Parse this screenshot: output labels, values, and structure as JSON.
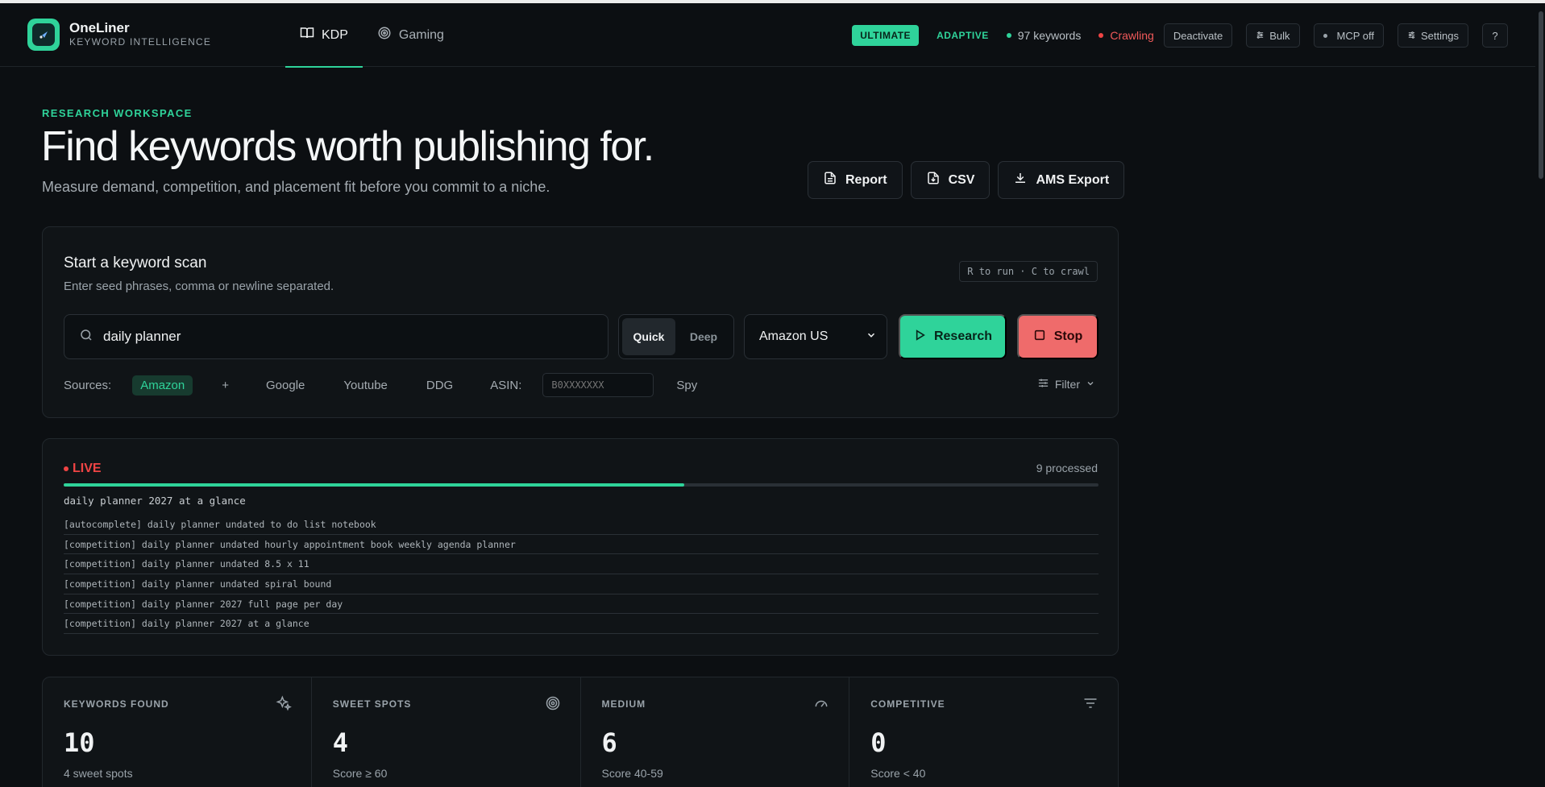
{
  "brand": {
    "name": "OneLiner",
    "subtitle": "KEYWORD INTELLIGENCE"
  },
  "nav": {
    "tabs": [
      {
        "label": "KDP",
        "icon": "book-icon",
        "active": true
      },
      {
        "label": "Gaming",
        "icon": "target-icon",
        "active": false
      }
    ]
  },
  "header": {
    "plan_badge": "ULTIMATE",
    "mode_label": "ADAPTIVE",
    "keywords_status": "97 keywords",
    "crawl_status": "Crawling",
    "deactivate": "Deactivate",
    "bulk": "Bulk",
    "mcp": "MCP off",
    "settings": "Settings",
    "help": "?"
  },
  "hero": {
    "eyebrow": "RESEARCH WORKSPACE",
    "title": "Find keywords worth publishing for.",
    "subtitle": "Measure demand, competition, and placement fit before you commit to a niche."
  },
  "actions": {
    "report": "Report",
    "csv": "CSV",
    "ams_export": "AMS Export"
  },
  "scan": {
    "title": "Start a keyword scan",
    "subtitle": "Enter seed phrases, comma or newline separated.",
    "shortcut_hint": "R to run · C to crawl",
    "query": "daily planner",
    "mode_quick": "Quick",
    "mode_deep": "Deep",
    "marketplace": "Amazon US",
    "research": "Research",
    "stop": "Stop",
    "sources_label": "Sources:",
    "src_amazon": "Amazon",
    "src_plus": "+",
    "src_google": "Google",
    "src_youtube": "Youtube",
    "src_ddg": "DDG",
    "asin_label": "ASIN:",
    "asin_placeholder": "B0XXXXXXX",
    "spy": "Spy",
    "filter": "Filter"
  },
  "live": {
    "label": "LIVE",
    "processed": "9 processed",
    "progress": 0.6,
    "current": "daily planner 2027 at a glance",
    "log": [
      "[autocomplete] daily planner undated to do list notebook",
      "[competition] daily planner undated hourly appointment book weekly agenda planner",
      "[competition] daily planner undated 8.5 x 11",
      "[competition] daily planner undated spiral bound",
      "[competition] daily planner 2027 full page per day",
      "[competition] daily planner 2027 at a glance"
    ]
  },
  "stats": [
    {
      "label": "KEYWORDS FOUND",
      "value": "10",
      "note": "4 sweet spots",
      "icon": "sparkles-icon"
    },
    {
      "label": "SWEET SPOTS",
      "value": "4",
      "note": "Score ≥ 60",
      "icon": "target-icon"
    },
    {
      "label": "MEDIUM",
      "value": "6",
      "note": "Score 40-59",
      "icon": "gauge-icon"
    },
    {
      "label": "COMPETITIVE",
      "value": "0",
      "note": "Score < 40",
      "icon": "filter-lines-icon"
    }
  ],
  "colors": {
    "accent": "#2fd39a",
    "danger": "#ef4444",
    "stop": "#ef6b6b",
    "background": "#0c0f12"
  }
}
